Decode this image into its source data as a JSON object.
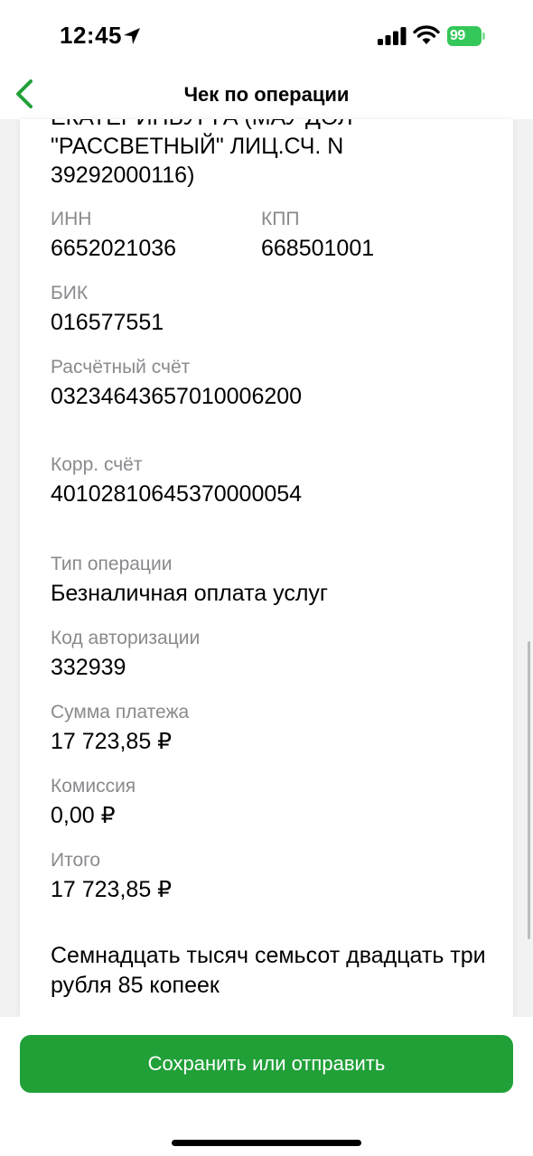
{
  "status_bar": {
    "time": "12:45",
    "battery": "99",
    "icons": [
      "location-arrow-icon",
      "signal-icon",
      "wifi-icon",
      "battery-icon"
    ],
    "battery_color": "#34c759"
  },
  "nav": {
    "back_icon": "chevron-left-icon",
    "title": "Чек по операции",
    "accent_color": "#21a038"
  },
  "receipt": {
    "recipient_lines": [
      "ЕКАТЕРИНБУРГА (МАУ ДОЛ",
      "\"РАССВЕТНЫЙ\" ЛИЦ.СЧ. N",
      "39292000116)"
    ],
    "inn": {
      "label": "ИНН",
      "value": "6652021036"
    },
    "kpp": {
      "label": "КПП",
      "value": "668501001"
    },
    "bik": {
      "label": "БИК",
      "value": "016577551"
    },
    "account": {
      "label": "Расчётный счёт",
      "value": "03234643657010006200"
    },
    "corr_account": {
      "label": "Корр. счёт",
      "value": "40102810645370000054"
    },
    "operation_type": {
      "label": "Тип операции",
      "value": "Безналичная оплата услуг"
    },
    "auth_code": {
      "label": "Код авторизации",
      "value": "332939"
    },
    "payment_sum": {
      "label": "Сумма платежа",
      "value": "17 723,85 ₽"
    },
    "commission": {
      "label": "Комиссия",
      "value": "0,00 ₽"
    },
    "total": {
      "label": "Итого",
      "value": "17 723,85 ₽"
    },
    "amount_in_words": "Семнадцать тысяч семьсот двадцать три рубля 85 копеек"
  },
  "actions": {
    "save_label": "Сохранить или отправить",
    "button_color": "#21a038"
  }
}
